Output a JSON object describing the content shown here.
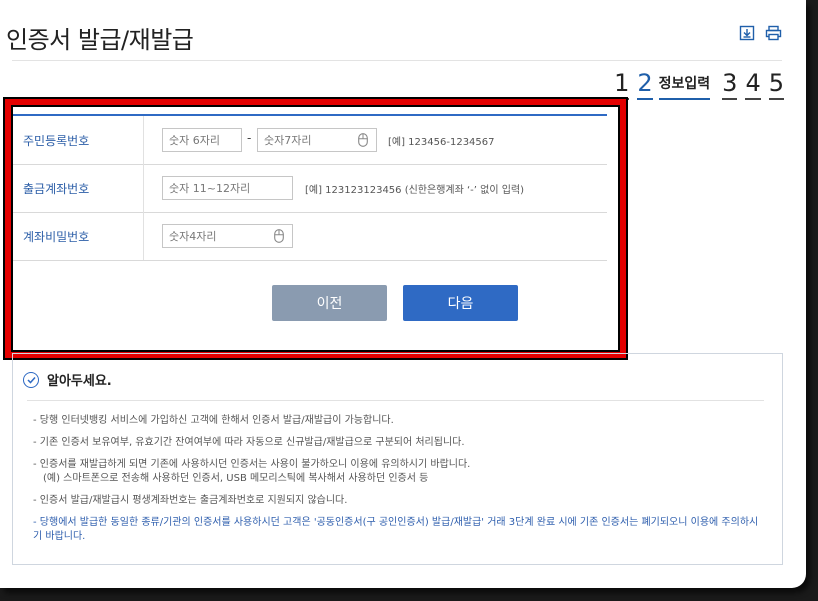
{
  "header": {
    "title": "인증서 발급/재발급",
    "download_icon": "download-icon",
    "print_icon": "print-icon"
  },
  "steps": {
    "items": [
      {
        "num": "1",
        "active": false
      },
      {
        "num": "2",
        "active": true,
        "label": "정보입력"
      },
      {
        "num": "3",
        "active": false
      },
      {
        "num": "4",
        "active": false
      },
      {
        "num": "5",
        "active": false
      }
    ]
  },
  "form": {
    "resident": {
      "label": "주민등록번호",
      "first_placeholder": "숫자 6자리",
      "separator": "-",
      "second_placeholder": "숫자7자리",
      "hint": "[예] 123456-1234567"
    },
    "account": {
      "label": "출금계좌번호",
      "placeholder": "숫자 11~12자리",
      "hint": "[예] 123123123456 (신한은행계좌 ‘-’ 없이 입력)"
    },
    "password": {
      "label": "계좌비밀번호",
      "placeholder": "숫자4자리"
    },
    "prev_label": "이전",
    "next_label": "다음"
  },
  "notice": {
    "title": "알아두세요.",
    "items": [
      "당행 인터넷뱅킹 서비스에 가입하신 고객에 한해서 인증서 발급/재발급이 가능합니다.",
      "기존 인증서 보유여부, 유효기간 잔여여부에 따라 자동으로 신규발급/재발급으로 구분되어 처리됩니다.",
      "인증서를 재발급하게 되면 기존에 사용하시던 인증서는 사용이 불가하오니 이용에 유의하시기 바랍니다.",
      "(예) 스마트폰으로 전송해 사용하던 인증서, USB 메모리스틱에 복사해서 사용하던 인증서 등",
      "인증서 발급/재발급시 평생계좌번호는 출금계좌번호로 지원되지 않습니다.",
      "당행에서 발급한 동일한 종류/기관의 인증서를 사용하시던 고객은 '공동인증서(구 공인인증서) 발급/재발급' 거래 3단계 완료 시에 기존 인증서는 폐기되오니 이용에 주의하시기 바랍니다."
    ]
  }
}
